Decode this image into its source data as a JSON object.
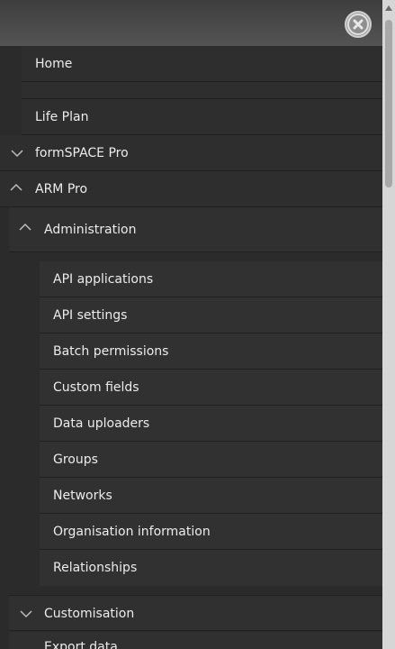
{
  "close": {
    "icon": "close-circle-icon"
  },
  "menu": {
    "home": "Home",
    "life_plan": "Life Plan",
    "formspace": "formSPACE Pro",
    "arm_pro": "ARM Pro",
    "administration": "Administration",
    "admin_items": [
      "API applications",
      "API settings",
      "Batch permissions",
      "Custom fields",
      "Data uploaders",
      "Groups",
      "Networks",
      "Organisation information",
      "Relationships"
    ],
    "customisation": "Customisation",
    "export_data": "Export data"
  },
  "colors": {
    "background": "#2b2b2b",
    "topbar": "#4a4a4a",
    "text": "#ececec",
    "scrollbar_track": "#d6d6d6",
    "scrollbar_thumb": "#a8a8a8"
  }
}
